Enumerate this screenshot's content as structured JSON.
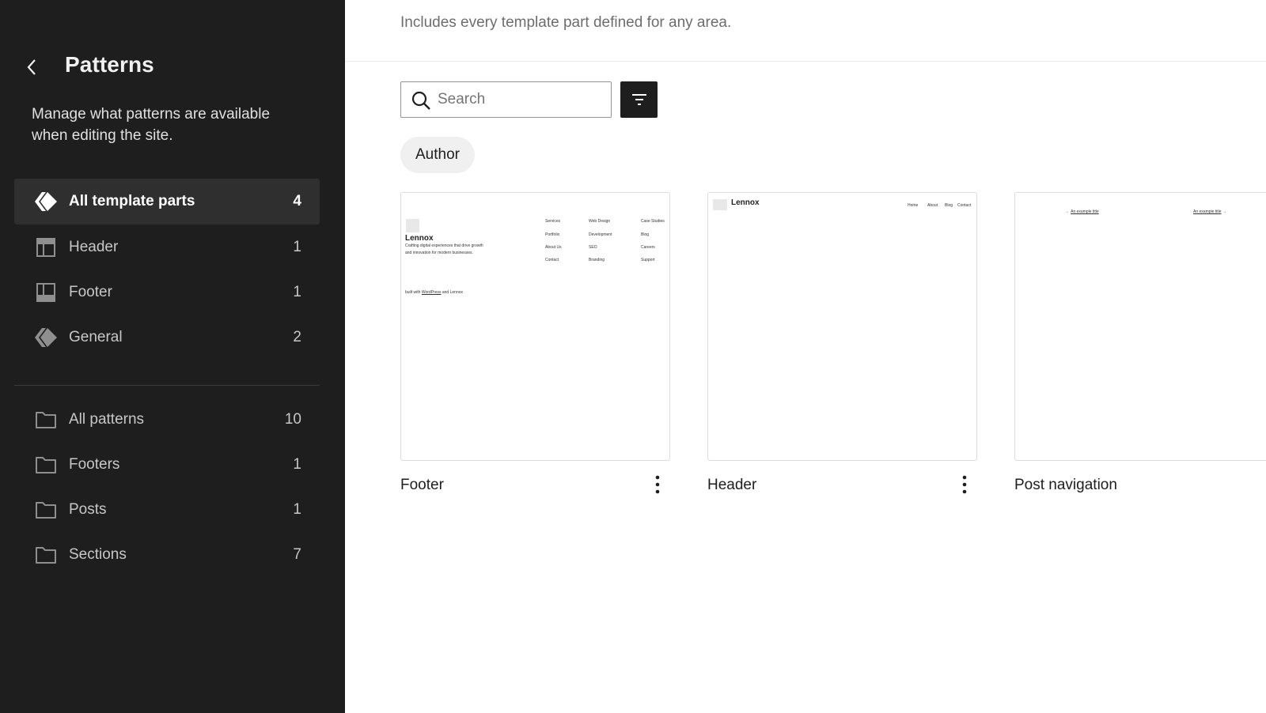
{
  "sidebar": {
    "title": "Patterns",
    "description": "Manage what patterns are available when editing the site.",
    "template_parts": [
      {
        "label": "All template parts",
        "count": "4",
        "icon": "symbol-icon",
        "active": true
      },
      {
        "label": "Header",
        "count": "1",
        "icon": "header-layout-icon"
      },
      {
        "label": "Footer",
        "count": "1",
        "icon": "footer-layout-icon"
      },
      {
        "label": "General",
        "count": "2",
        "icon": "symbol-icon"
      }
    ],
    "categories": [
      {
        "label": "All patterns",
        "count": "10",
        "icon": "folder-icon"
      },
      {
        "label": "Footers",
        "count": "1",
        "icon": "folder-icon"
      },
      {
        "label": "Posts",
        "count": "1",
        "icon": "folder-icon"
      },
      {
        "label": "Sections",
        "count": "7",
        "icon": "folder-icon"
      }
    ]
  },
  "main": {
    "description": "Includes every template part defined for any area.",
    "search": {
      "placeholder": "Search",
      "value": ""
    },
    "filter_chip": "Author",
    "cards": [
      {
        "title": "Footer",
        "preview": {
          "brand": "Lennox",
          "tagline_1": "Crafting digital experiences that drive growth",
          "tagline_2": "and innovation for modern businesses.",
          "links": [
            [
              "Services",
              "Web Design",
              "Case Studies"
            ],
            [
              "Portfolio",
              "Development",
              "Blog"
            ],
            [
              "About Us",
              "SEO",
              "Careers"
            ],
            [
              "Contact",
              "Branding",
              "Support"
            ]
          ],
          "credit_prefix": "built with",
          "credit_link": "WordPress",
          "credit_suffix": "and Lennox"
        }
      },
      {
        "title": "Header",
        "preview": {
          "brand": "Lennox",
          "nav": [
            "Home",
            "About",
            "Blog",
            "Contact"
          ]
        }
      },
      {
        "title": "Post navigation",
        "preview": {
          "prev_arrow": "←",
          "prev_title": "An example title",
          "next_title": "An example title",
          "next_arrow": "→"
        }
      }
    ]
  },
  "colors": {
    "sidebar_bg": "#1e1e1e",
    "active_item_bg": "#2f2f2f",
    "primary_button": "#1e1e1e",
    "chip_bg": "#f0f0f0"
  }
}
